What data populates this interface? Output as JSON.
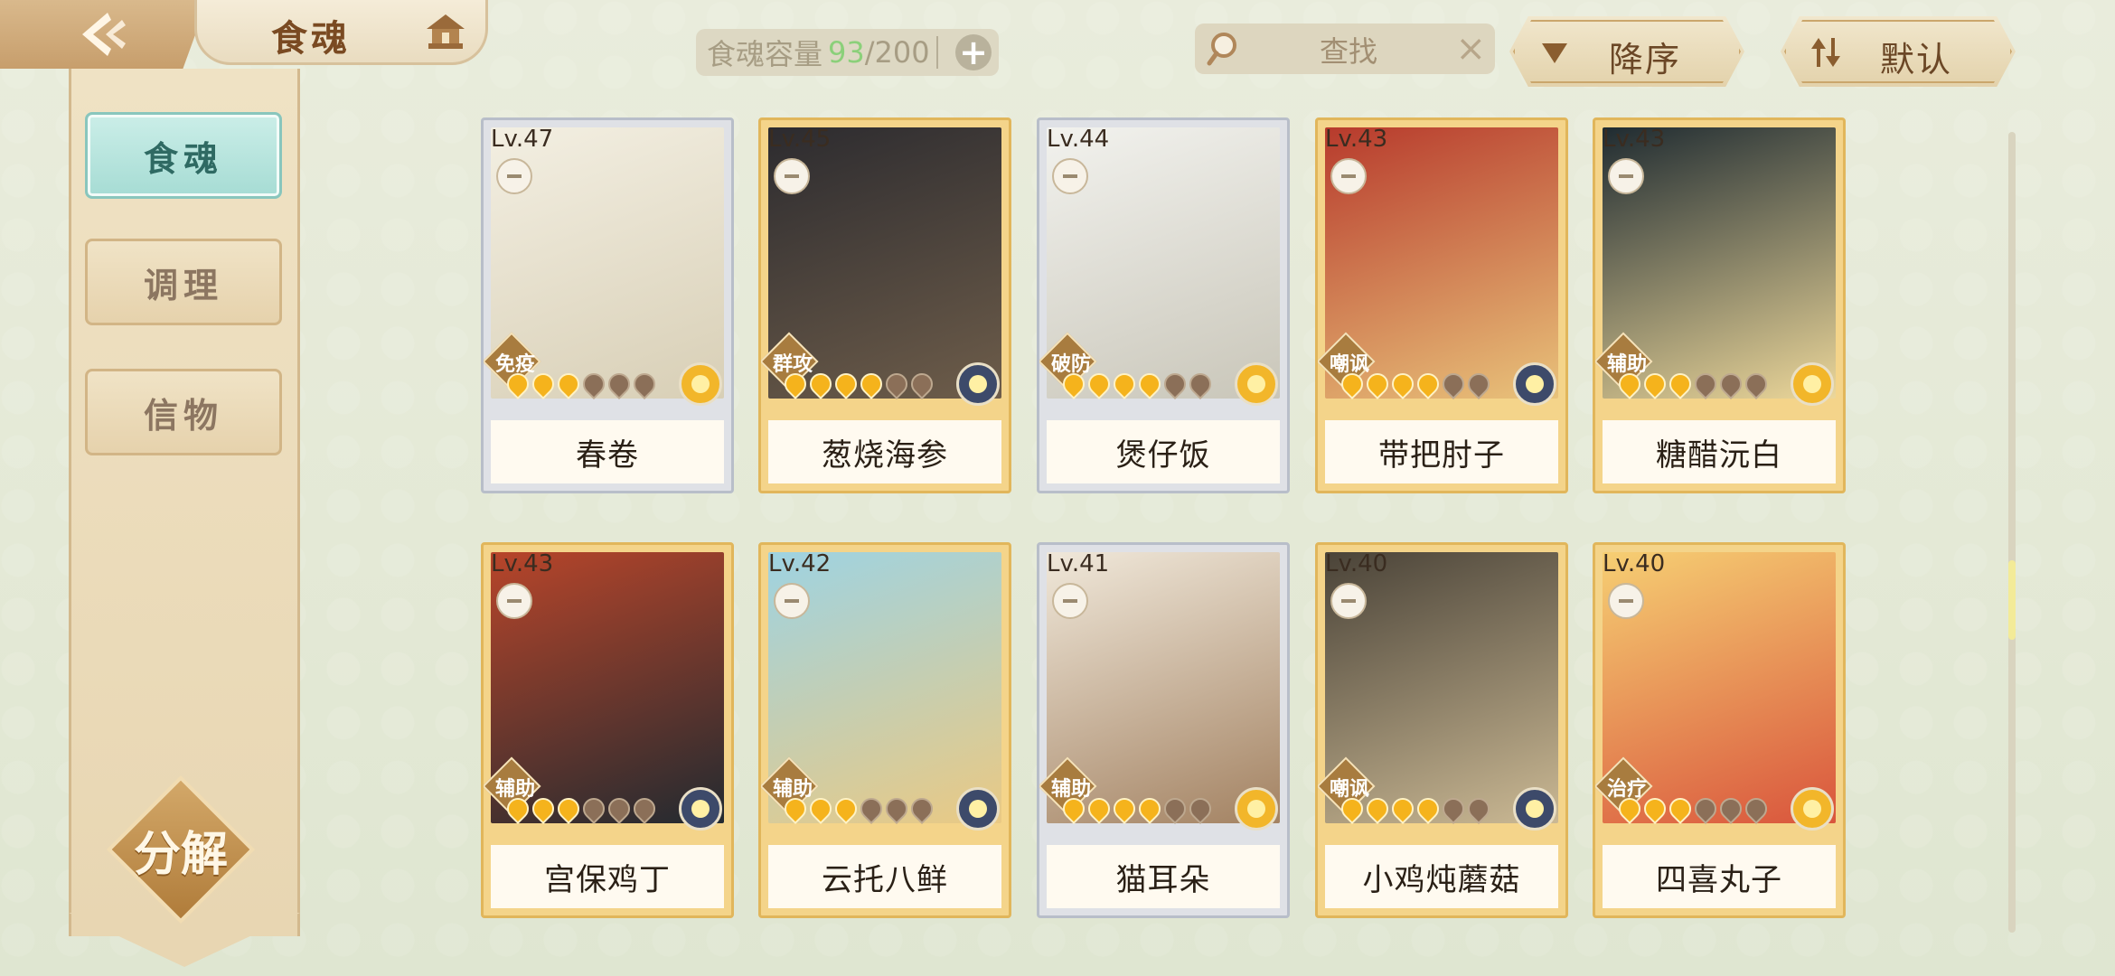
{
  "header": {
    "title": "食魂",
    "capacity_label": "食魂容量",
    "capacity_current": "93",
    "capacity_max": "/200",
    "search_label": "查找",
    "sort_label": "降序",
    "filter_label": "默认"
  },
  "sidebar": {
    "tabs": [
      {
        "label": "食魂"
      },
      {
        "label": "调理"
      },
      {
        "label": "信物"
      }
    ],
    "decompose_label": "分解"
  },
  "cards": [
    {
      "level": "Lv.47",
      "name": "春卷",
      "role": "免疫",
      "stars": 3,
      "element": "gold",
      "frame": "silver",
      "portrait": [
        "#f3efe2",
        "#d8cfb6"
      ]
    },
    {
      "level": "Lv.45",
      "name": "葱烧海参",
      "role": "群攻",
      "stars": 4,
      "element": "dark",
      "frame": "gold",
      "portrait": [
        "#2c2b2f",
        "#6e5d4a"
      ]
    },
    {
      "level": "Lv.44",
      "name": "煲仔饭",
      "role": "破防",
      "stars": 4,
      "element": "gold",
      "frame": "silver",
      "portrait": [
        "#f2f2ee",
        "#c9c6b9"
      ]
    },
    {
      "level": "Lv.43",
      "name": "带把肘子",
      "role": "嘲讽",
      "stars": 4,
      "element": "dark",
      "frame": "gold",
      "portrait": [
        "#b73a2c",
        "#e9c37b"
      ]
    },
    {
      "level": "Lv.43",
      "name": "糖醋沅白",
      "role": "辅助",
      "stars": 3,
      "element": "gold",
      "frame": "gold",
      "portrait": [
        "#1f2b31",
        "#ecd79a"
      ]
    },
    {
      "level": "Lv.43",
      "name": "宫保鸡丁",
      "role": "辅助",
      "stars": 3,
      "element": "dark",
      "frame": "gold",
      "portrait": [
        "#b8452a",
        "#222a30"
      ]
    },
    {
      "level": "Lv.42",
      "name": "云托八鲜",
      "role": "辅助",
      "stars": 3,
      "element": "dark",
      "frame": "gold",
      "portrait": [
        "#9ed3e2",
        "#eac983"
      ]
    },
    {
      "level": "Lv.41",
      "name": "猫耳朵",
      "role": "辅助",
      "stars": 4,
      "element": "gold",
      "frame": "silver",
      "portrait": [
        "#f0e8da",
        "#a38262"
      ]
    },
    {
      "level": "Lv.40",
      "name": "小鸡炖蘑菇",
      "role": "嘲讽",
      "stars": 4,
      "element": "dark",
      "frame": "gold",
      "portrait": [
        "#4a4338",
        "#cbb994"
      ]
    },
    {
      "level": "Lv.40",
      "name": "四喜丸子",
      "role": "治疗",
      "stars": 3,
      "element": "gold",
      "frame": "gold",
      "portrait": [
        "#f6cf73",
        "#d9553c"
      ]
    }
  ]
}
